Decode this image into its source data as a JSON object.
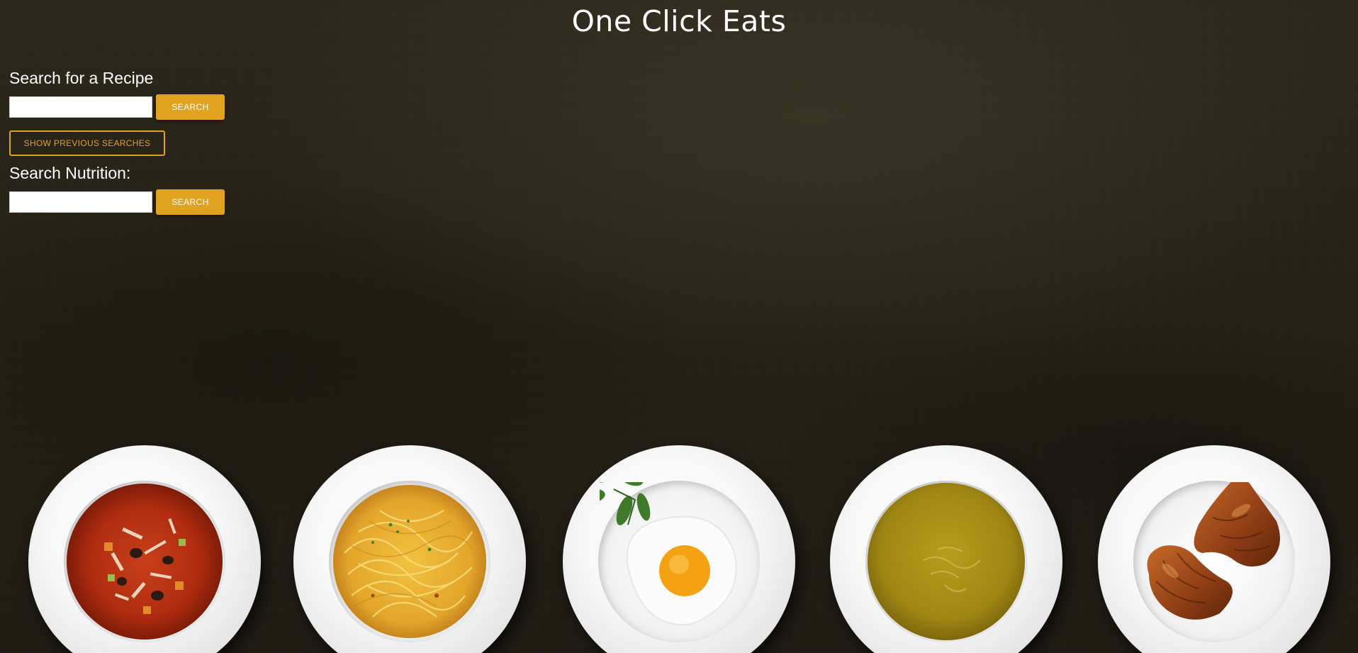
{
  "header": {
    "title": "One Click Eats"
  },
  "recipe_search": {
    "heading": "Search for a Recipe",
    "input_value": "",
    "search_label": "SEARCH",
    "history_label": "SHOW PREVIOUS SEARCHES"
  },
  "nutrition_search": {
    "heading": "Search Nutrition:",
    "input_value": "",
    "search_label": "SEARCH"
  },
  "plates": [
    {
      "dish": "minestrone-soup"
    },
    {
      "dish": "spaghetti"
    },
    {
      "dish": "fried-egg"
    },
    {
      "dish": "pea-soup"
    },
    {
      "dish": "croissants"
    }
  ],
  "colors": {
    "accent": "#e0a21f",
    "background": "#2a2519",
    "title_text": "#ffffff"
  }
}
